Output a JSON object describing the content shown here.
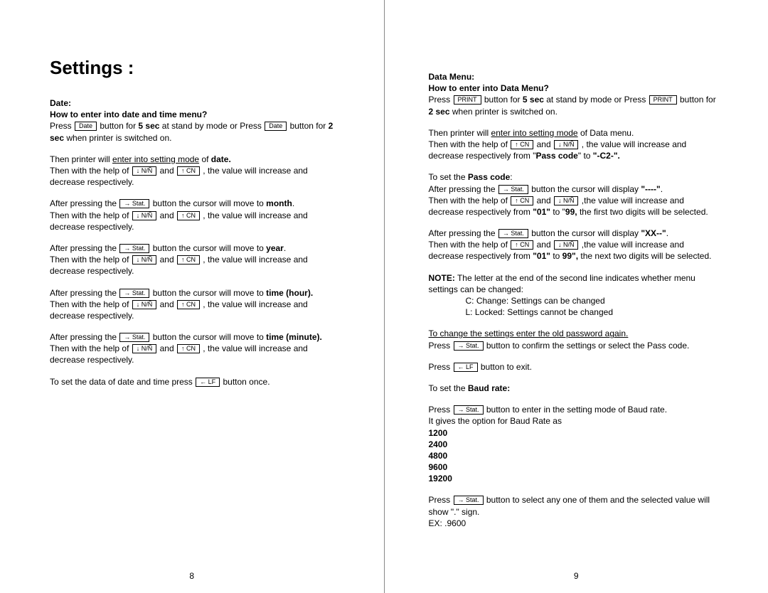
{
  "left": {
    "heading": "Settings :",
    "section_title_1": "Date:",
    "section_title_2": "How to enter into date and time menu?",
    "btn_date": "Date",
    "btn_nn_down": "↓ N/Ñ",
    "btn_cn_up": "↑ CN",
    "btn_stat": "→ Stat.",
    "btn_lf": "← LF",
    "p1_a": "Press ",
    "p1_b": " button for ",
    "p1_c": "5 sec",
    "p1_d": " at stand by mode or Press ",
    "p1_e": " button for ",
    "p1_f": "2 sec",
    "p1_g": " when printer is switched on.",
    "p2_a": "Then printer will ",
    "p2_a_u": "enter into setting mode",
    "p2_b": " of ",
    "p2_c": "date.",
    "p3_a": "Then with the help of ",
    "p3_b": " and ",
    "p3_c": " , the value will increase and decrease respectively.",
    "m_a": "After pressing the ",
    "m_b": " button the cursor will move to ",
    "m_month": "month",
    "m_year": "year",
    "m_hour": "time (hour).",
    "m_minute": "time (minute).",
    "final_a": "To set the data of date and time press ",
    "final_b": " button once.",
    "pagenum": "8"
  },
  "right": {
    "section_title_1": "Data Menu:",
    "section_title_2": "How to enter into Data Menu?",
    "btn_print": "PRINT",
    "btn_cn_up": "↑ CN",
    "btn_nn_down": "↓ N/Ñ",
    "btn_stat": "→ Stat.",
    "btn_lf": "← LF",
    "r1_a": "Press ",
    "r1_b": " button for ",
    "r1_c": "5 sec",
    "r1_d": " at stand by mode or Press ",
    "r1_e": " button for ",
    "r1_f": "2 sec",
    "r1_g": " when printer is switched on.",
    "r2_a": "Then printer will ",
    "r2_a_u": "enter into setting mode",
    "r2_b": " of Data menu.",
    "r3_a": "Then with the help of ",
    "r3_b": " and ",
    "r3_c": " , the value will increase and decrease respectively from \"",
    "r3_d": "Pass code",
    "r3_e": "\" to ",
    "r3_f": "\"-C2-\".",
    "set_pass": "To set the ",
    "set_pass_b": "Pass code",
    "set_pass_c": ":",
    "rp_a": "After pressing the ",
    "rp_b": " button the cursor will display ",
    "rp_dash": "\"----\"",
    "rp_xx": "\"XX--\"",
    "rp_dot": ".",
    "rp2_a": "Then with the help of ",
    "rp2_b": " and ",
    "rp2_c": " ,the value will increase and decrease respectively from ",
    "rp2_01": "\"01\"",
    "rp2_to": " to \"",
    "rp2_99": "99,",
    "rp2_99b": "99\",",
    "rp2_first": " the first two digits will be selected.",
    "rp2_next": " the next two digits will be selected.",
    "note_label": "NOTE:",
    "note_text": " The letter at the end of the second line indicates whether  menu settings can be changed:",
    "note_c": "C: Change: Settings can be changed",
    "note_l": "L: Locked: Settings cannot be changed",
    "chg_a": "To change the settings enter the old password again.",
    "chg_b": "Press ",
    "chg_c": " button to confirm the settings or select the Pass code.",
    "exit_a": "Press ",
    "exit_b": " button to exit.",
    "baud_label_a": "To set the ",
    "baud_label_b": "Baud rate:",
    "baud_a": "Press ",
    "baud_b": " button to enter in the setting mode of Baud rate.",
    "baud_c": "It gives the option for Baud Rate as",
    "rate1": "1200",
    "rate2": "2400",
    "rate3": "4800",
    "rate4": "9600",
    "rate5": "19200",
    "sel_a": "Press ",
    "sel_b": " button to select any one of them and the selected value will show \".\" sign.",
    "sel_ex": "EX: .9600",
    "pagenum": "9"
  }
}
